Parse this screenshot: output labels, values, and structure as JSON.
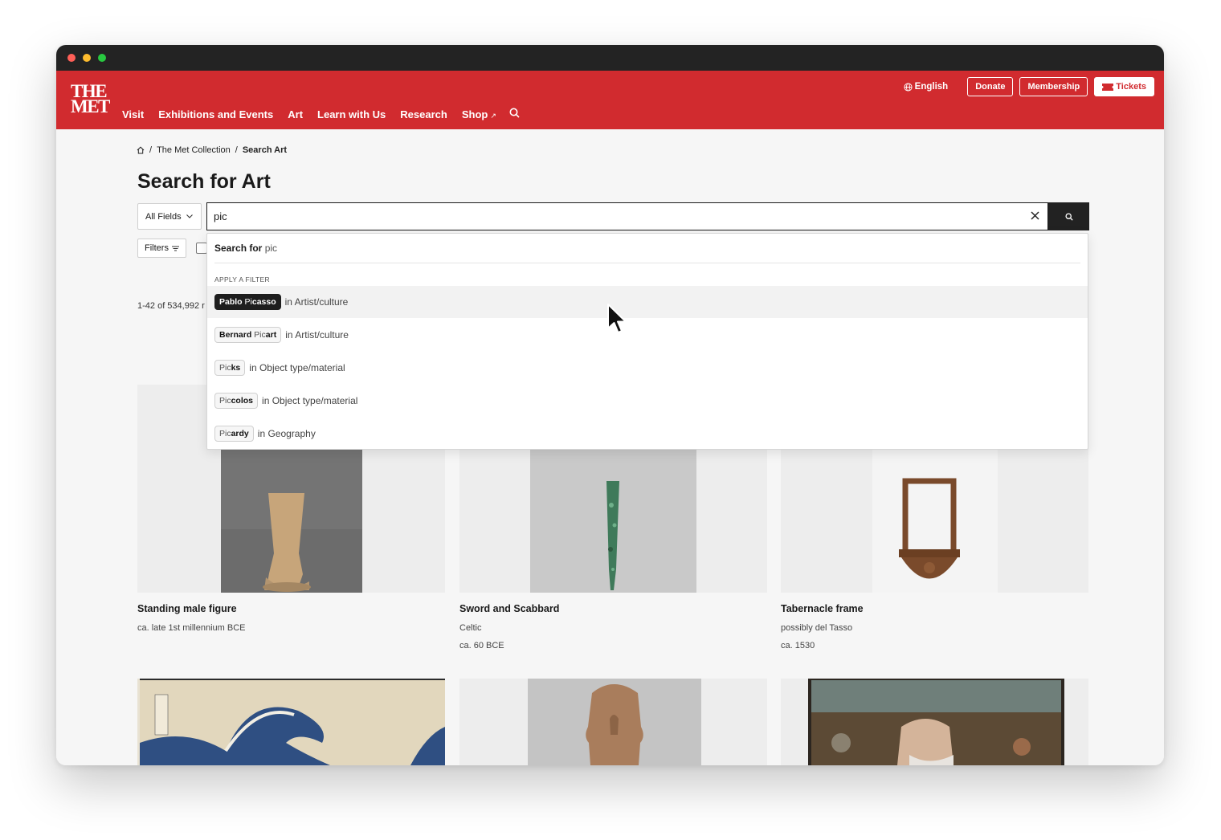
{
  "nav": {
    "logo_line1": "THE",
    "logo_line2": "MET",
    "items": [
      {
        "label": "Visit"
      },
      {
        "label": "Exhibitions and Events"
      },
      {
        "label": "Art"
      },
      {
        "label": "Learn with Us"
      },
      {
        "label": "Research"
      },
      {
        "label": "Shop",
        "external_marker": "↗"
      }
    ],
    "language": "English",
    "donate": "Donate",
    "membership": "Membership",
    "tickets": "Tickets"
  },
  "breadcrumb": {
    "items": [
      "The Met Collection",
      "Search Art"
    ],
    "separator": "/"
  },
  "page": {
    "title": "Search for Art"
  },
  "search": {
    "field_select": "All Fields",
    "query": "pic"
  },
  "filters": {
    "label": "Filters"
  },
  "results": {
    "count_text": "1-42 of 534,992 r"
  },
  "dropdown": {
    "search_prefix": "Search for",
    "search_query": "pic",
    "apply_filter_label": "APPLY A FILTER",
    "suggestions": [
      {
        "prefix": "Pablo Pi",
        "match": "casso",
        "full_before": "Pablo ",
        "full_after": "",
        "category": "in Artist/culture",
        "active": true
      },
      {
        "prefix": "Bernard ",
        "match": "",
        "full_before": "",
        "full_after": "",
        "category": "in Artist/culture",
        "active": false
      },
      {
        "prefix": "Pic",
        "match": "ks",
        "category": "in Object type/material",
        "active": false
      },
      {
        "prefix": "Pic",
        "match": "colos",
        "category": "in Object type/material",
        "active": false
      },
      {
        "prefix": "Pic",
        "match": "ardy",
        "category": "in Geography",
        "active": false
      }
    ],
    "chip_texts": {
      "s0_a": "Pablo",
      "s0_b": " Pi",
      "s0_c": "casso",
      "s1_a": "Bernard",
      "s1_b": " Pic",
      "s1_c": "art",
      "s2_a": "Pic",
      "s2_b": "ks",
      "s3_a": "Pic",
      "s3_b": "colos",
      "s4_a": "Pic",
      "s4_b": "ardy"
    }
  },
  "cards": [
    {
      "title": "Standing male figure",
      "meta1": "ca. late 1st millennium BCE",
      "meta2": ""
    },
    {
      "title": "Sword and Scabbard",
      "meta1": "Celtic",
      "meta2": "ca. 60 BCE"
    },
    {
      "title": "Tabernacle frame",
      "meta1": "possibly del Tasso",
      "meta2": "ca. 1530"
    }
  ],
  "colors": {
    "brand_red": "#d12b2f",
    "dark": "#1e1e1e"
  }
}
